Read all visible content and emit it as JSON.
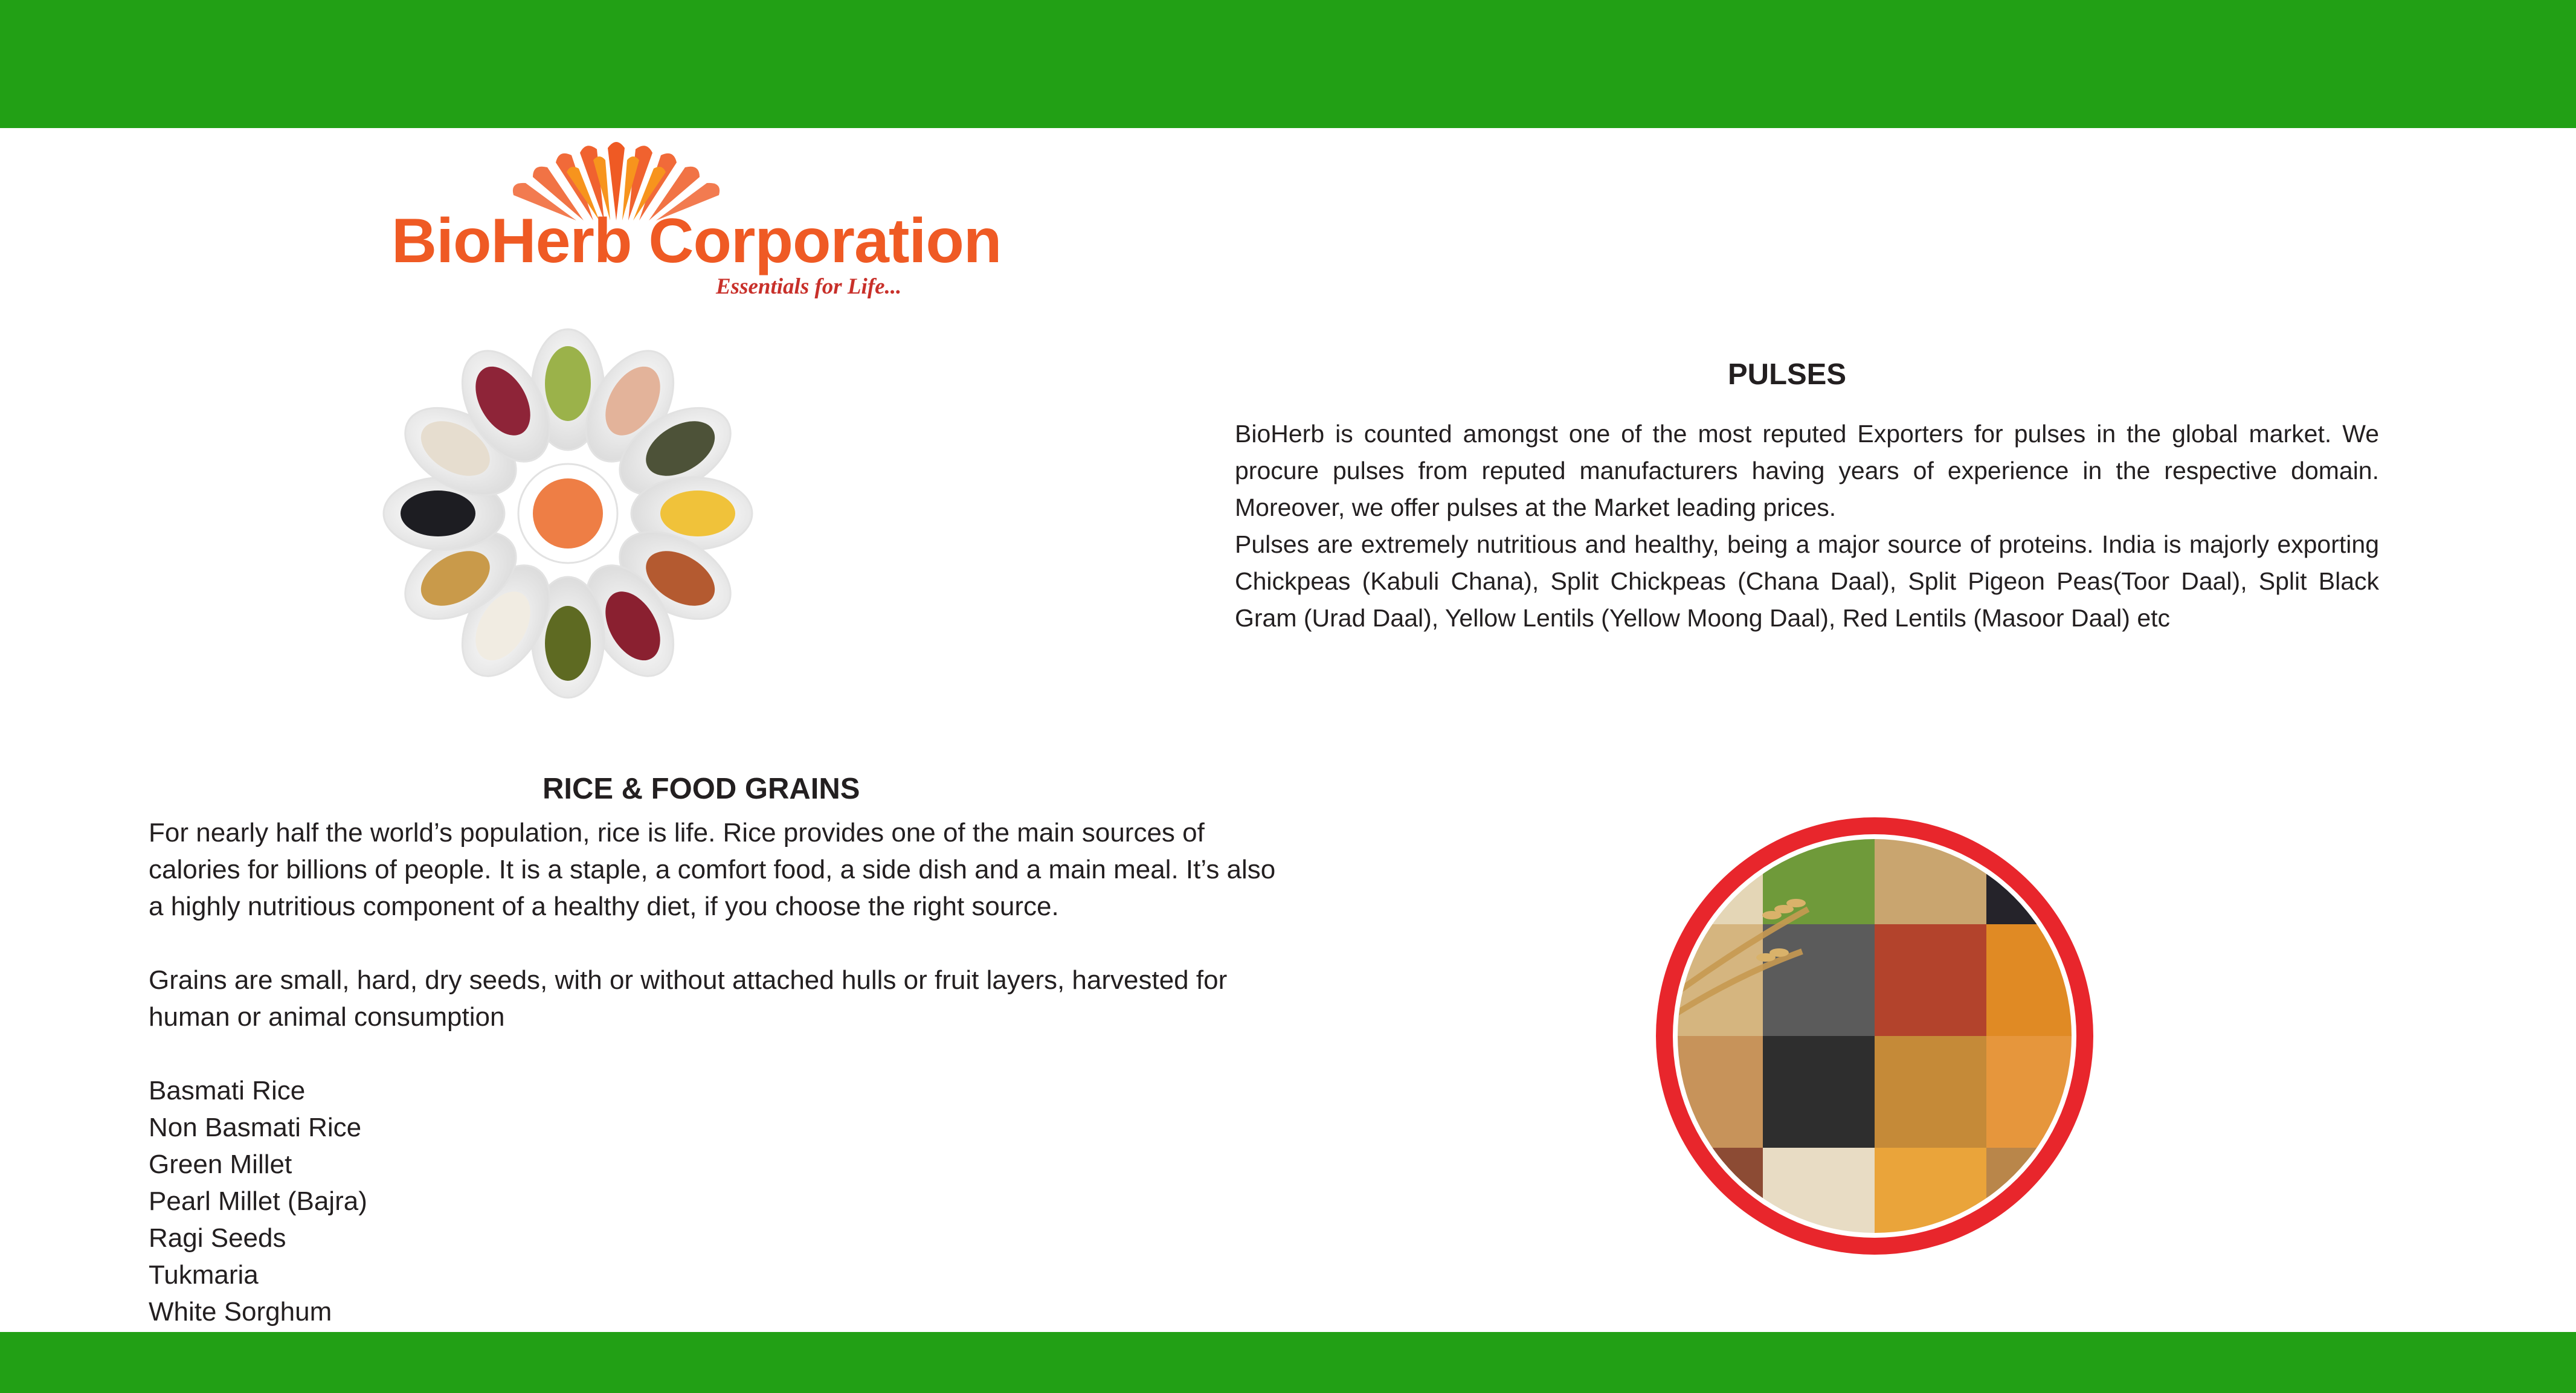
{
  "brand": {
    "name": "BioHerb Corporation",
    "tagline": "Essentials for Life...",
    "colors": {
      "green_band": "#22a015",
      "logo_orange": "#ef5a24",
      "circle_red": "#e8262c"
    }
  },
  "pulses": {
    "heading": "PULSES",
    "paragraph1": "BioHerb  is counted amongst one of the most reputed Exporters for pulses in the global market. We procure pulses from reputed manufacturers having years of experience in the respective domain. Moreover, we offer pulses at the Market leading prices.",
    "paragraph2": "Pulses  are extremely nutritious and healthy, being a major source of proteins. India is majorly exporting Chickpeas (Kabuli Chana), Split Chickpeas (Chana Daal), Split Pigeon Peas(Toor Daal), Split Black Gram (Urad Daal), Yellow Lentils (Yellow Moong Daal), Red Lentils (Masoor Daal) etc"
  },
  "rice": {
    "heading": "RICE  & FOOD GRAINS",
    "paragraph1": "For nearly half the world’s population, rice is life. Rice provides one of the main sources of calories for billions of people. It is a staple, a comfort food, a side dish and a main meal. It’s also a highly nutritious component of a healthy diet, if you choose the right source.",
    "paragraph2": "Grains are small, hard, dry seeds, with or without attached hulls or fruit layers, harvested for human or animal consumption",
    "items": [
      "Basmati Rice",
      "Non Basmati Rice",
      "Green Millet",
      "Pearl Millet (Bajra)",
      "Ragi Seeds",
      "Tukmaria",
      "White Sorghum"
    ]
  }
}
